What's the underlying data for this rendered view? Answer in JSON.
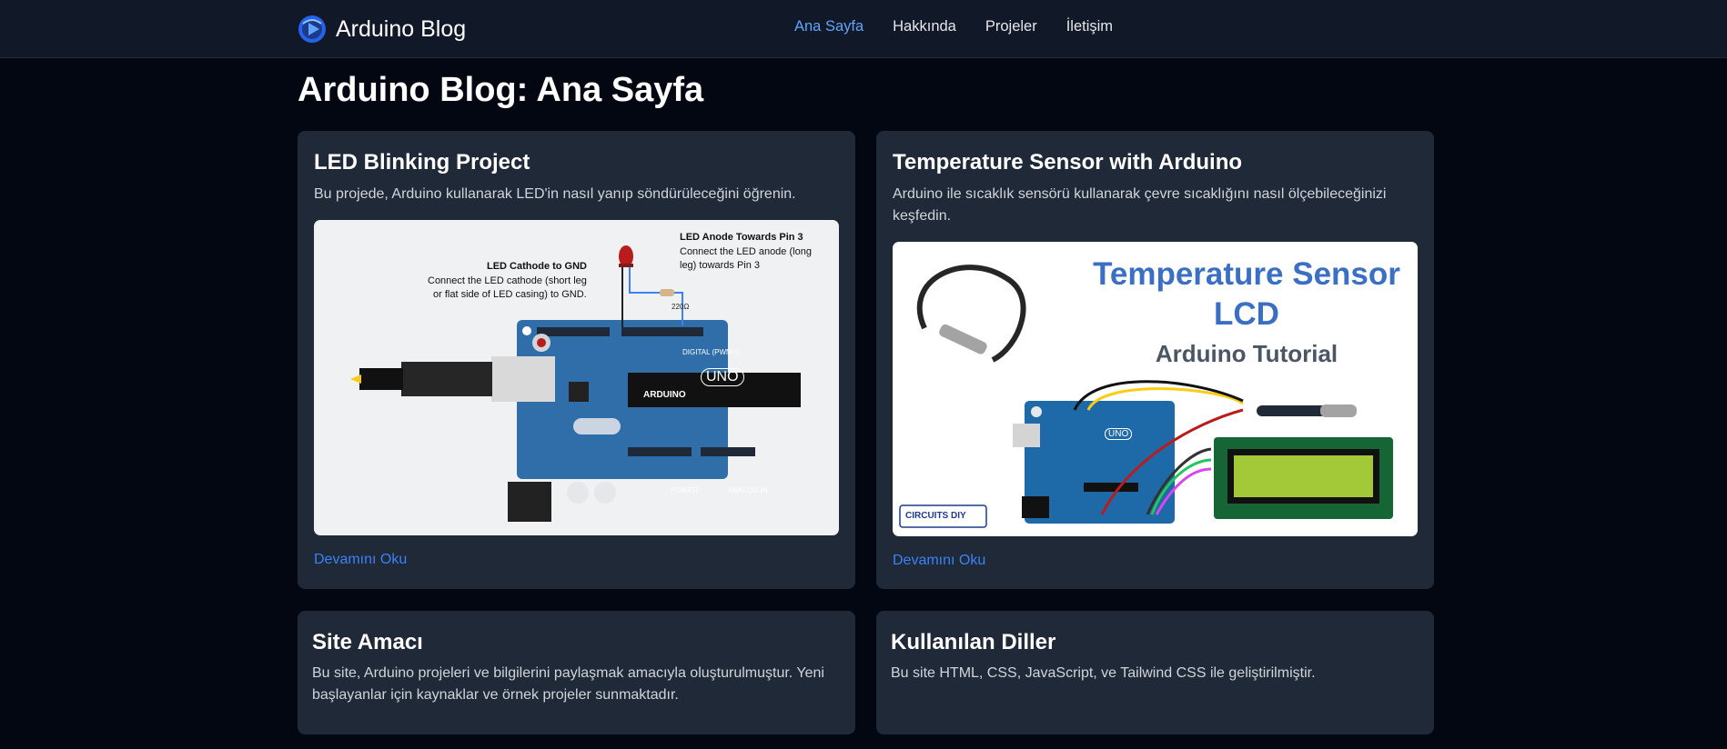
{
  "nav": {
    "brand": "Arduino Blog",
    "links": [
      {
        "label": "Ana Sayfa",
        "active": true
      },
      {
        "label": "Hakkında",
        "active": false
      },
      {
        "label": "Projeler",
        "active": false
      },
      {
        "label": "İletişim",
        "active": false
      }
    ]
  },
  "page_title": "Arduino Blog: Ana Sayfa",
  "projects": [
    {
      "title": "LED Blinking Project",
      "description": "Bu projede, Arduino kullanarak LED'in nasıl yanıp söndürüleceğini öğrenin.",
      "read_more": "Devamını Oku",
      "image": {
        "cathode_title": "LED Cathode to GND",
        "cathode_line1": "Connect the LED cathode (short leg",
        "cathode_line2": "or flat side of LED casing) to GND.",
        "anode_title": "LED Anode Towards Pin 3",
        "anode_line1": "Connect the LED anode (long",
        "anode_line2": "leg) towards Pin 3",
        "resistor": "220Ω",
        "board_brand": "ARDUINO",
        "board_model": "UNO",
        "digital_label": "DIGITAL (PWM~)",
        "power_label": "POWER",
        "analog_label": "ANALOG IN"
      }
    },
    {
      "title": "Temperature Sensor with Arduino",
      "description": "Arduino ile sıcaklık sensörü kullanarak çevre sıcaklığını nasıl ölçebileceğinizi keşfedin.",
      "read_more": "Devamını Oku",
      "image": {
        "heading_line1": "Temperature Sensor",
        "heading_line2": "LCD",
        "subheading": "Arduino Tutorial",
        "logo": "CIRCUITS DIY",
        "board_model": "UNO"
      }
    }
  ],
  "info": [
    {
      "title": "Site Amacı",
      "text": "Bu site, Arduino projeleri ve bilgilerini paylaşmak amacıyla oluşturulmuştur. Yeni başlayanlar için kaynaklar ve örnek projeler sunmaktadır."
    },
    {
      "title": "Kullanılan Diller",
      "text": "Bu site HTML, CSS, JavaScript, ve Tailwind CSS ile geliştirilmiştir."
    }
  ],
  "colors": {
    "background": "#030712",
    "nav": "#111827",
    "card": "#1f2937",
    "accent": "#60a5fa",
    "link": "#3b82f6",
    "board": "#2f6ea8"
  }
}
